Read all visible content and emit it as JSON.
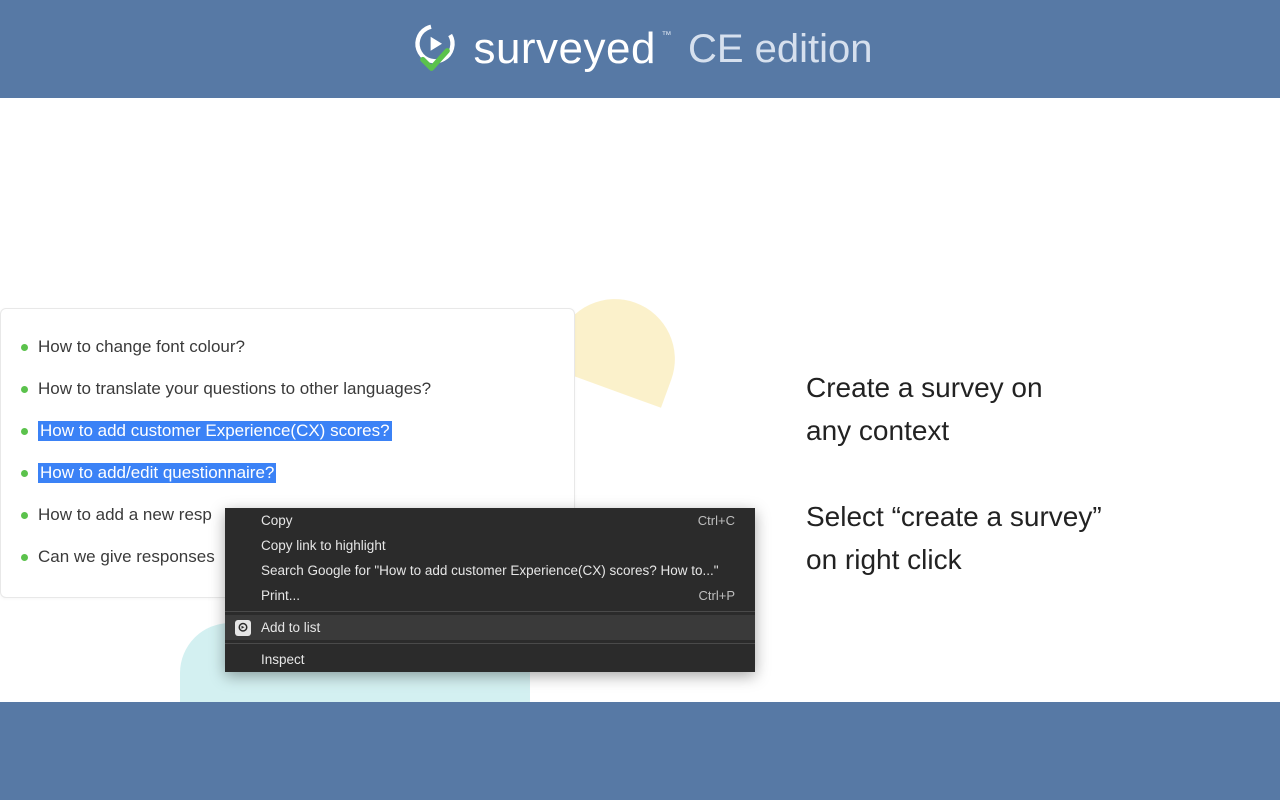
{
  "header": {
    "brand": "surveyed",
    "tm": "™",
    "edition": "CE edition"
  },
  "card": {
    "items": [
      {
        "label": "How to change font colour?",
        "selected": false
      },
      {
        "label": "How to translate your questions to other languages?",
        "selected": false
      },
      {
        "label": "How to add customer Experience(CX) scores?",
        "selected": true
      },
      {
        "label": "How to add/edit questionnaire?",
        "selected": true
      },
      {
        "label": "How to add a new resp",
        "selected": false
      },
      {
        "label": "Can we give responses",
        "selected": false
      }
    ]
  },
  "context_menu": {
    "items": [
      {
        "label": "Copy",
        "shortcut": "Ctrl+C"
      },
      {
        "label": "Copy link to highlight",
        "shortcut": ""
      },
      {
        "label": "Search Google for \"How to add customer Experience(CX) scores? How to...\"",
        "shortcut": ""
      },
      {
        "label": "Print...",
        "shortcut": "Ctrl+P"
      },
      {
        "label": "Add to list",
        "shortcut": "",
        "highlight": true,
        "icon": true
      },
      {
        "label": "Inspect",
        "shortcut": ""
      }
    ]
  },
  "right": {
    "line1": "Create a survey on",
    "line2": "any context",
    "line3": "Select “create a survey”",
    "line4": "on right click"
  }
}
